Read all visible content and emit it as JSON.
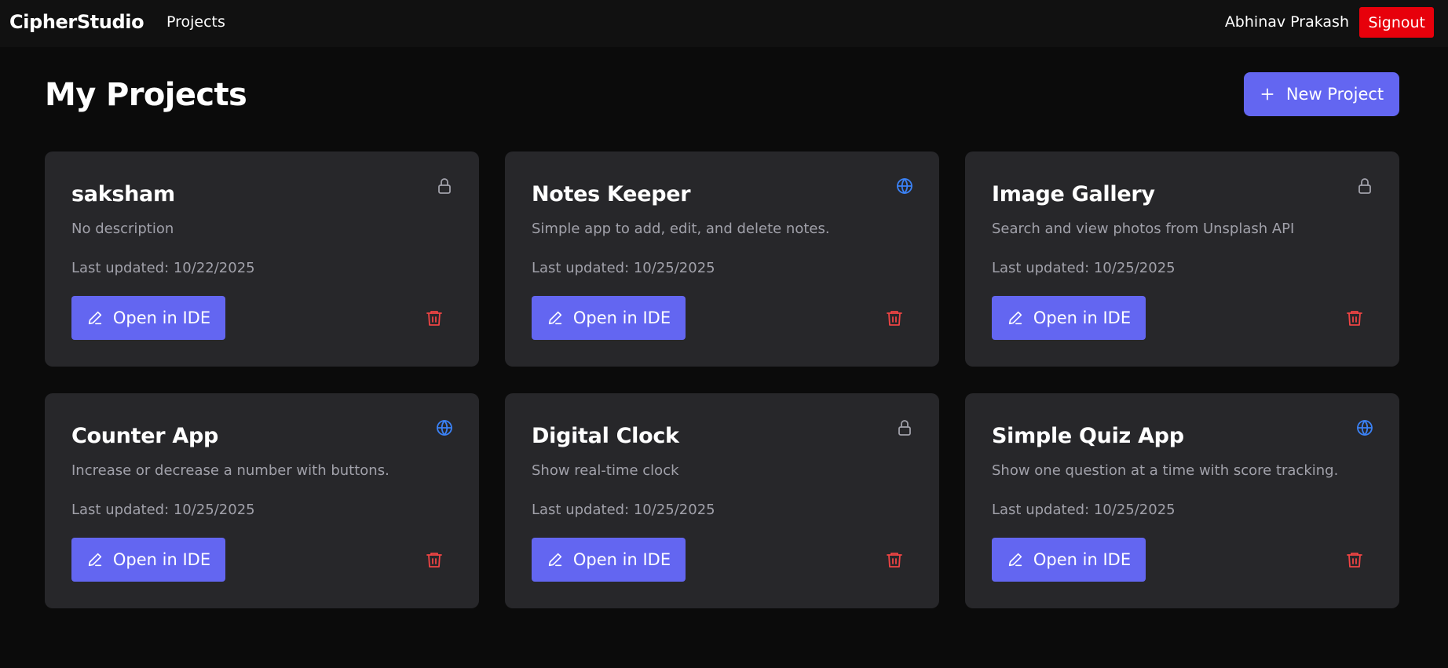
{
  "nav": {
    "brand": "CipherStudio",
    "projects_link": "Projects",
    "username": "Abhinav Prakash",
    "signout_label": "Signout"
  },
  "page": {
    "title": "My Projects",
    "new_project_label": "New Project"
  },
  "colors": {
    "accent": "#6366f1",
    "signout": "#e7000b",
    "delete": "#ef4444",
    "public_icon": "#3b82f6",
    "private_icon": "#a1a1aa",
    "card_bg": "#27272a"
  },
  "projects": [
    {
      "name": "saksham",
      "description": "No description",
      "last_updated": "Last updated: 10/22/2025",
      "visibility_icon": "lock-icon",
      "open_label": "Open in IDE"
    },
    {
      "name": "Notes Keeper",
      "description": "Simple app to add, edit, and delete notes.",
      "last_updated": "Last updated: 10/25/2025",
      "visibility_icon": "globe-icon",
      "open_label": "Open in IDE"
    },
    {
      "name": "Image Gallery",
      "description": "Search and view photos from Unsplash API",
      "last_updated": "Last updated: 10/25/2025",
      "visibility_icon": "lock-icon",
      "open_label": "Open in IDE"
    },
    {
      "name": "Counter App",
      "description": "Increase or decrease a number with buttons.",
      "last_updated": "Last updated: 10/25/2025",
      "visibility_icon": "globe-icon",
      "open_label": "Open in IDE"
    },
    {
      "name": "Digital Clock",
      "description": "Show real-time clock",
      "last_updated": "Last updated: 10/25/2025",
      "visibility_icon": "lock-icon",
      "open_label": "Open in IDE"
    },
    {
      "name": "Simple Quiz App",
      "description": "Show one question at a time with score tracking.",
      "last_updated": "Last updated: 10/25/2025",
      "visibility_icon": "globe-icon",
      "open_label": "Open in IDE"
    }
  ]
}
